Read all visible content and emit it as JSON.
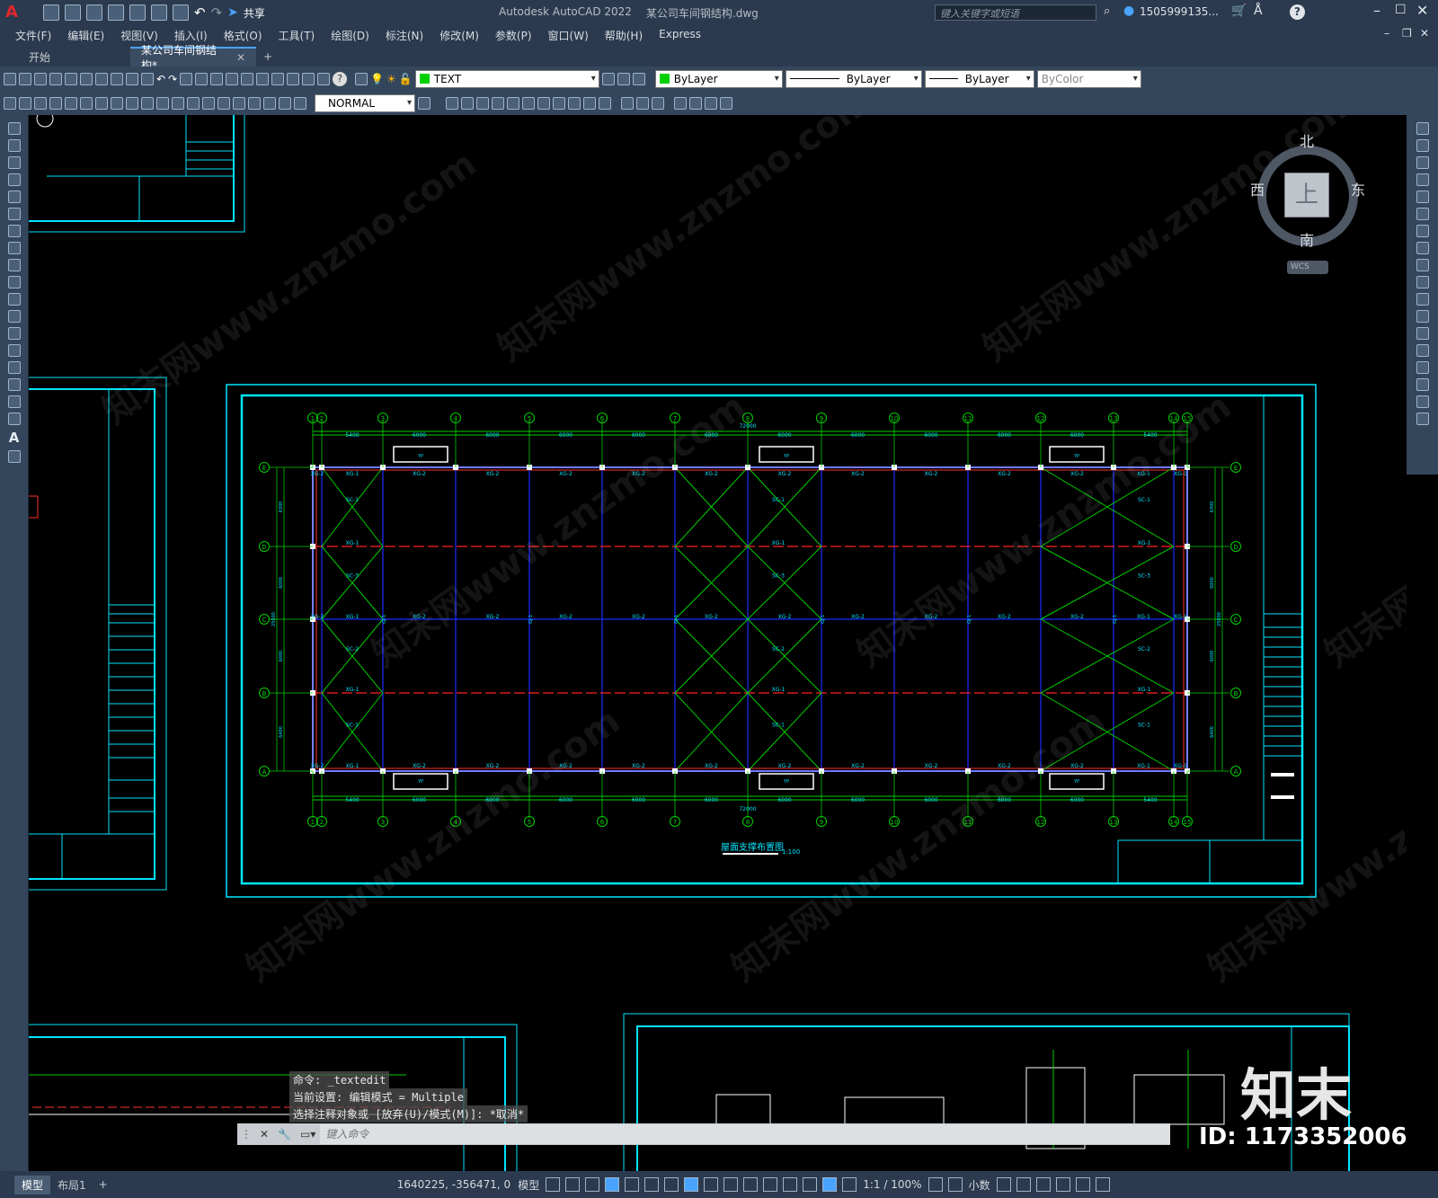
{
  "titlebar": {
    "app_title": "Autodesk AutoCAD 2022",
    "doc_title": "某公司车间钢结构.dwg",
    "share_label": "共享",
    "search_placeholder": "键入关键字或短语",
    "user": "1505999135...",
    "help": "?"
  },
  "menu": [
    "文件(F)",
    "编辑(E)",
    "视图(V)",
    "插入(I)",
    "格式(O)",
    "工具(T)",
    "绘图(D)",
    "标注(N)",
    "修改(M)",
    "参数(P)",
    "窗口(W)",
    "帮助(H)",
    "Express"
  ],
  "tabs": {
    "start": "开始",
    "doc": "某公司车间钢结构*"
  },
  "layer": {
    "name": "TEXT",
    "color": "#00d000"
  },
  "props": {
    "color": "ByLayer",
    "linetype": "ByLayer",
    "lineweight": "ByLayer",
    "plotstyle": "ByColor"
  },
  "dimstyle": "NORMAL",
  "viewcube": {
    "north": "北",
    "south": "南",
    "east": "东",
    "west": "西",
    "top": "上",
    "wcs": "WCS"
  },
  "drawing": {
    "title": "屋面支撑布置图",
    "scale": "1:100",
    "total_dim": "72000",
    "top_dims": [
      "5400",
      "6000",
      "6000",
      "6000",
      "6000",
      "6000",
      "6000",
      "6000",
      "6000",
      "6000",
      "6000",
      "5400"
    ],
    "col_labels": [
      "1",
      "2",
      "3",
      "4",
      "5",
      "6",
      "7",
      "8",
      "9",
      "10",
      "11",
      "12",
      "13",
      "14",
      "15"
    ],
    "row_labels": [
      "E",
      "D",
      "C",
      "B",
      "A"
    ],
    "side_dims": [
      "6300",
      "6000",
      "6000",
      "6400"
    ],
    "total_side": "25000",
    "members": {
      "xg1": "XG-1",
      "xg2": "XG-2",
      "sc1": "SC-1",
      "sc2": "SC-2",
      "sc3": "SC-3",
      "sc4": "SC-4",
      "gj": "GJ-1",
      "yp": "YP"
    }
  },
  "cmd": {
    "line1": "命令: _textedit",
    "line2": "当前设置: 编辑模式 = Multiple",
    "line3": "选择注释对象或 [放弃(U)/模式(M)]: *取消*",
    "input_placeholder": "键入命令"
  },
  "status": {
    "model_tab": "模型",
    "layout_tab": "布局1",
    "coords": "1640225, -356471, 0",
    "model": "模型",
    "scale": "1:1 / 100%",
    "units": "小数"
  },
  "watermark": {
    "site": "知末网www.znzmo.com",
    "brand": "知末",
    "id": "ID: 1173352006"
  }
}
